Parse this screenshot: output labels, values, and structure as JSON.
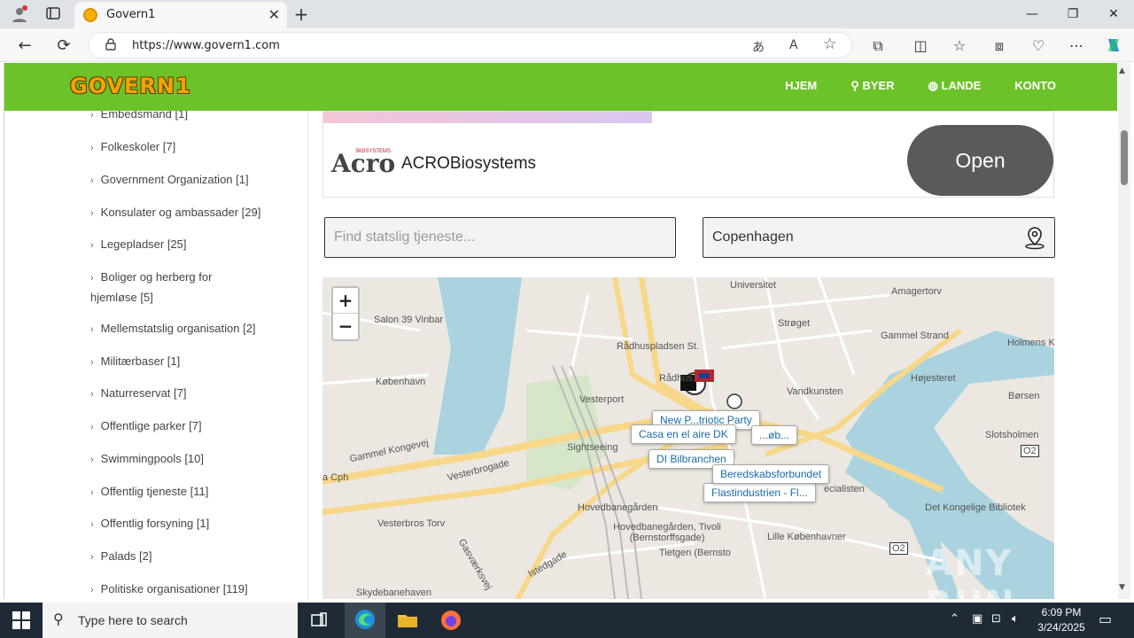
{
  "browser": {
    "tab_title": "Govern1",
    "url": "https://www.govern1.com",
    "new_tab": "+",
    "window_controls": {
      "minimize": "—",
      "maximize": "❐",
      "close": "✕"
    }
  },
  "site": {
    "logo_text": "GOVERN1",
    "nav": [
      "HJEM",
      "BYER",
      "LANDE",
      "KONTO"
    ],
    "brand_color": "#6cc229"
  },
  "sidebar": {
    "categories": [
      "Embedsmand [1]",
      "Folkeskoler [7]",
      "Government Organization [1]",
      "Konsulater og ambassader [29]",
      "Legepladser [25]",
      "Boliger og herberg for hjemløse [5]",
      "Mellemstatslig organisation [2]",
      "Militærbaser [1]",
      "Naturreservat [7]",
      "Offentlige parker [7]",
      "Swimmingpools [10]",
      "Offentlig tjeneste [11]",
      "Offentlig forsyning [1]",
      "Palads [2]",
      "Politiske organisationer [119]"
    ]
  },
  "ad": {
    "brand_small": "BIOSYSTEMS",
    "logo": "Acro",
    "name": "ACROBiosystems",
    "cta": "Open"
  },
  "search": {
    "service_placeholder": "Find statslig tjeneste...",
    "location_value": "Copenhagen"
  },
  "map": {
    "zoom_in": "+",
    "zoom_out": "−",
    "labels": [
      "Universitet",
      "Amagertorv",
      "Salon 39 Vinbar",
      "Strøget",
      "Gammel Strand",
      "Holmens K",
      "Rådhuspladsen St.",
      "Rådhus",
      "Højesteret",
      "København",
      "Vandkunsten",
      "Børsen",
      "Vesterport",
      "Slotsholmen",
      "Sightseeing",
      "Gammel Kongevej",
      "Vesterbrogade",
      "Hovedbanegården",
      "Det Kongelige Bibliotek",
      "Vesterbros Torv",
      "Hovedbanegården, Tivoli (Bernstorffsgade)",
      "Lille Københavner",
      "Skydebanehaven",
      "Istedgade",
      "Gasværksvej",
      "O2",
      "O2",
      "ecialisten",
      "a Cph",
      "Tietgen (Bernsto"
    ],
    "popups": [
      "Casa en el aire DK",
      "DI Bilbranchen",
      "Beredskabsforbundet",
      "Flastindustrien - Fl...",
      "New P...triotic Party",
      "...øb..."
    ],
    "watermark": "ANY RUN"
  },
  "taskbar": {
    "search_placeholder": "Type here to search",
    "time": "6:09 PM",
    "date": "3/24/2025"
  }
}
